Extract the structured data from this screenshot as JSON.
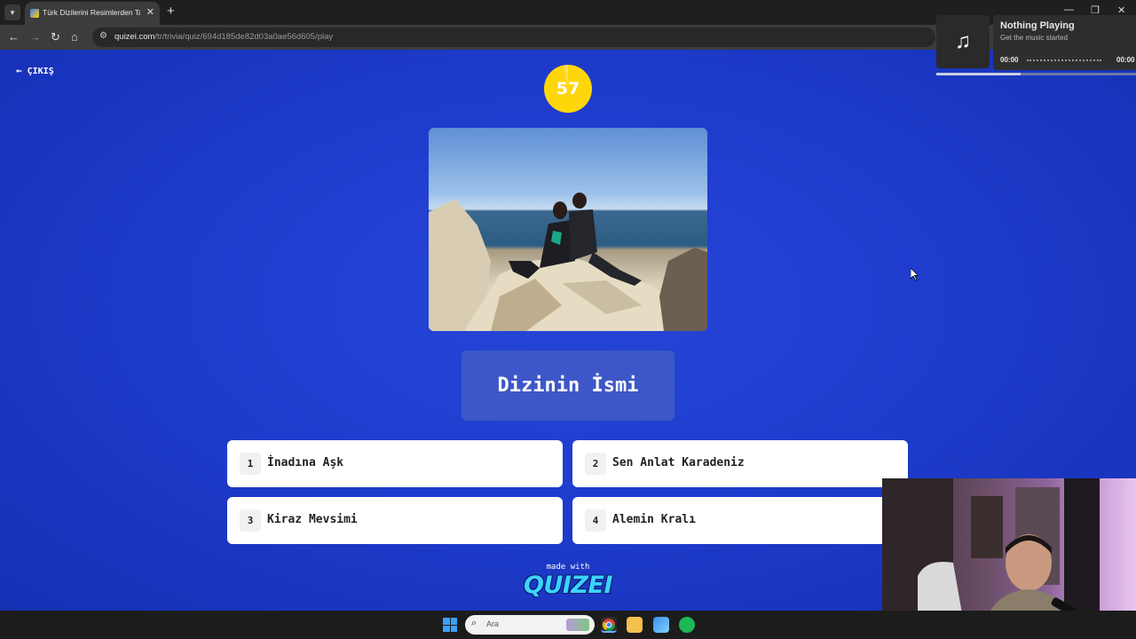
{
  "browser": {
    "tab_title": "Türk Dizilerini Resimlerden Tahmin",
    "tab_close": "✕",
    "new_tab": "+",
    "url_host": "quizei.com",
    "url_path": "/tr/trivia/quiz/694d185de82d03a0ae56d605/play",
    "window_controls": [
      "—",
      "❐",
      "✕"
    ]
  },
  "page": {
    "exit_label": "ÇIKIŞ",
    "timer": "57",
    "question": "Dizinin İsmi",
    "answers": [
      {
        "num": "1",
        "text": "İnadına Aşk"
      },
      {
        "num": "2",
        "text": "Sen Anlat Karadeniz"
      },
      {
        "num": "3",
        "text": "Kiraz Mevsimi"
      },
      {
        "num": "4",
        "text": "Alemin Kralı"
      }
    ],
    "made_with": "made with",
    "brand": "QUIZEI"
  },
  "media": {
    "title": "Nothing Playing",
    "subtitle": "Get the music started",
    "time_start": "00:00",
    "time_end": "00:00",
    "progress": 0.42
  },
  "taskbar": {
    "search_placeholder": "Ara"
  },
  "colors": {
    "page_bg": "#1f3ccd",
    "timer": "#ffd60a",
    "question_card": "#3d57c9",
    "brand": "#3ad4ff"
  }
}
